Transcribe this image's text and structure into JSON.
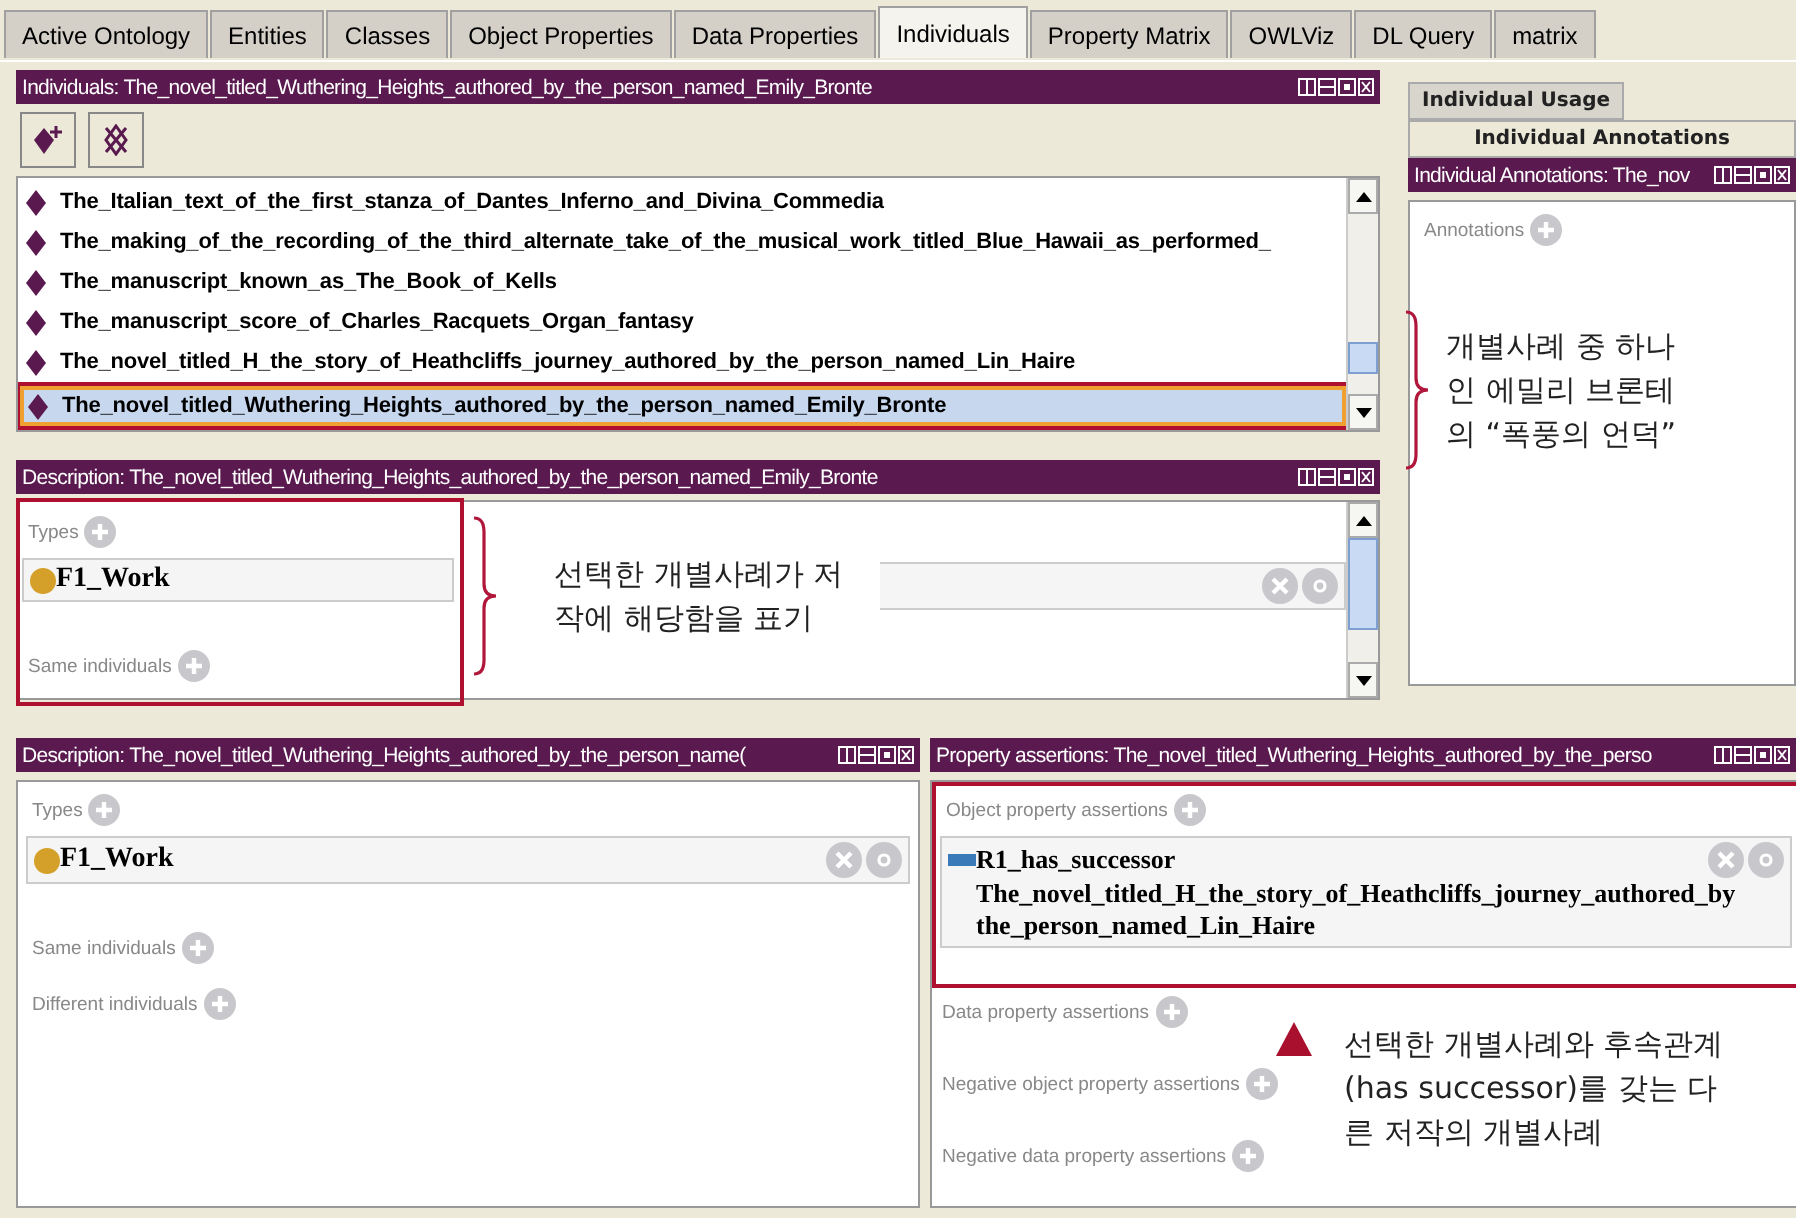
{
  "tabs": [
    {
      "label": "Active Ontology",
      "selected": false
    },
    {
      "label": "Entities",
      "selected": false
    },
    {
      "label": "Classes",
      "selected": false
    },
    {
      "label": "Object Properties",
      "selected": false
    },
    {
      "label": "Data Properties",
      "selected": false
    },
    {
      "label": "Individuals",
      "selected": true
    },
    {
      "label": "Property Matrix",
      "selected": false
    },
    {
      "label": "OWLViz",
      "selected": false
    },
    {
      "label": "DL Query",
      "selected": false
    },
    {
      "label": "matrix",
      "selected": false
    }
  ],
  "individuals_panel": {
    "title": "Individuals: The_novel_titled_Wuthering_Heights_authored_by_the_person_named_Emily_Bronte",
    "items": [
      {
        "label": "The_Italian_text_of_the_first_stanza_of_Dantes_Inferno_and_Divina_Commedia",
        "selected": false
      },
      {
        "label": "The_making_of_the_recording_of_the_third_alternate_take_of_the_musical_work_titled_Blue_Hawaii_as_performed_",
        "selected": false
      },
      {
        "label": "The_manuscript_known_as_The_Book_of_Kells",
        "selected": false
      },
      {
        "label": "The_manuscript_score_of_Charles_Racquets_Organ_fantasy",
        "selected": false
      },
      {
        "label": "The_novel_titled_H_the_story_of_Heathcliffs_journey_authored_by_the_person_named_Lin_Haire",
        "selected": false
      },
      {
        "label": "The_novel_titled_Wuthering_Heights_authored_by_the_person_named_Emily_Bronte",
        "selected": true
      }
    ]
  },
  "description_panel": {
    "title": "Description: The_novel_titled_Wuthering_Heights_authored_by_the_person_named_Emily_Bronte",
    "sections": [
      {
        "label": "Types",
        "items": [
          {
            "label": "F1_Work"
          }
        ]
      },
      {
        "label": "Same individuals"
      }
    ]
  },
  "usage_tabs": [
    {
      "label": "Individual Usage",
      "selected": false
    },
    {
      "label": "Individual Annotations",
      "selected": true
    }
  ],
  "annotations_panel": {
    "title": "Individual Annotations: The_nov",
    "sections": [
      {
        "label": "Annotations"
      }
    ]
  },
  "bottom_description": {
    "title": "Description: The_novel_titled_Wuthering_Heights_authored_by_the_person_name(",
    "sections": [
      {
        "label": "Types",
        "items": [
          {
            "label": "F1_Work"
          }
        ]
      },
      {
        "label": "Same individuals"
      },
      {
        "label": "Different individuals"
      }
    ]
  },
  "property_assertions": {
    "title": "Property assertions: The_novel_titled_Wuthering_Heights_authored_by_the_perso",
    "sections": [
      {
        "label": "Object property assertions",
        "items": [
          {
            "property": "R1_has_successor",
            "value_lines": [
              "The_novel_titled_H_the_story_of_Heathcliffs_journey_authored_by",
              "the_person_named_Lin_Haire"
            ]
          }
        ]
      },
      {
        "label": "Data property assertions"
      },
      {
        "label": "Negative object property assertions"
      },
      {
        "label": "Negative data property assertions"
      }
    ]
  },
  "callouts": [
    {
      "lines": [
        "개별사례 중 하나",
        "인 에밀리 브론테",
        "의 “폭풍의 언덕”"
      ]
    },
    {
      "lines": [
        "선택한 개별사례가 저",
        "작에 해당함을 표기"
      ]
    },
    {
      "lines": [
        "선택한 개별사례와 후속관계",
        "(has successor)를 갖는 다",
        "른 저작의 개별사례"
      ]
    }
  ]
}
